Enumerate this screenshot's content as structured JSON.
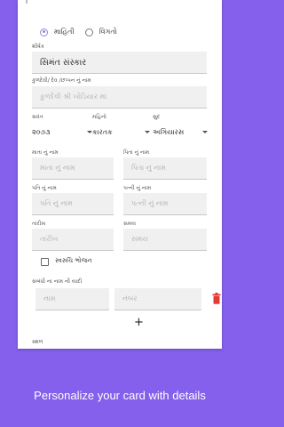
{
  "type_selector": {
    "options": [
      {
        "label": "માહિતી",
        "checked": true
      },
      {
        "label": "વિગતો",
        "checked": false
      }
    ]
  },
  "title": {
    "label": "શીર્ષક",
    "value": "સિમંત સંસ્કાર"
  },
  "deity": {
    "label": "કુળદેવી/ દેવ /છપ્પન નું નામ",
    "placeholder": "કુળદેવી શ્રી ખોડિયાર માં"
  },
  "date_selectors": {
    "samvat": {
      "label": "સવંત",
      "value": "૨૦૭૩"
    },
    "month": {
      "label": "મહિનો",
      "value": "કારતક"
    },
    "paksh": {
      "label": "સુદ",
      "value": "અગિયારસ"
    }
  },
  "mother_name": {
    "label": "માતા નું નામ",
    "placeholder": "માતા નું નામ"
  },
  "father_name": {
    "label": "પિતા નું નામ",
    "placeholder": "પિતા નું નામ"
  },
  "husband_name": {
    "label": "પતિ નું નામ",
    "placeholder": "પતિ નું નામ"
  },
  "wife_name": {
    "label": "પત્ની નું નામ",
    "placeholder": "પત્ની નું નામ"
  },
  "date": {
    "label": "તારીખ",
    "placeholder": "તારીખ"
  },
  "time": {
    "label": "સમય",
    "placeholder": "સમય"
  },
  "dinner": {
    "label": "સ્વરુચિ ભોજન",
    "checked": false
  },
  "relatives": {
    "label": "સંબંધી ના નામ ની યાદી",
    "name_placeholder": "નામ",
    "number_placeholder": "નંબર",
    "add_label": "+"
  },
  "place": {
    "label": "સ્થળ"
  },
  "caption": "Personalize your card with details",
  "colors": {
    "background": "#8460ec",
    "radio_accent": "#8c8ad8",
    "trash": "#e53935"
  }
}
